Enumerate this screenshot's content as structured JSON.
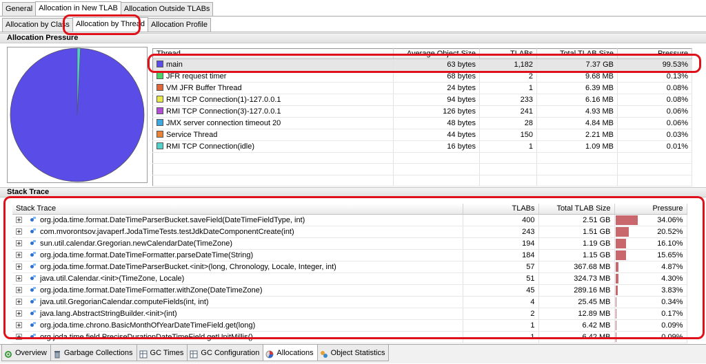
{
  "top_tabs": [
    "General",
    "Allocation in New TLAB",
    "Allocation Outside TLABs"
  ],
  "sub_tabs": [
    "Allocation by Class",
    "Allocation by Thread",
    "Allocation Profile"
  ],
  "pressure_section": {
    "title": "Allocation Pressure"
  },
  "pie": {
    "main_fraction": 0.9953,
    "main_color": "#5a4ce6",
    "other_color": "#55d0c8"
  },
  "thread_table": {
    "headers": [
      "Thread",
      "Average Object Size",
      "TLABs",
      "Total TLAB Size",
      "Pressure"
    ],
    "rows": [
      {
        "color": "#5a4ce6",
        "name": "main",
        "avg": "63 bytes",
        "tlabs": "1,182",
        "size": "7.37 GB",
        "pressure": "99.53%"
      },
      {
        "color": "#4fd16a",
        "name": "JFR request timer",
        "avg": "68 bytes",
        "tlabs": "2",
        "size": "9.68 MB",
        "pressure": "0.13%"
      },
      {
        "color": "#e0663c",
        "name": "VM JFR Buffer Thread",
        "avg": "24 bytes",
        "tlabs": "1",
        "size": "6.39 MB",
        "pressure": "0.08%"
      },
      {
        "color": "#e8e84a",
        "name": "RMI TCP Connection(1)-127.0.0.1",
        "avg": "94 bytes",
        "tlabs": "233",
        "size": "6.16 MB",
        "pressure": "0.08%"
      },
      {
        "color": "#b14fd6",
        "name": "RMI TCP Connection(3)-127.0.0.1",
        "avg": "126 bytes",
        "tlabs": "241",
        "size": "4.93 MB",
        "pressure": "0.06%"
      },
      {
        "color": "#3fa8e0",
        "name": "JMX server connection timeout 20",
        "avg": "48 bytes",
        "tlabs": "28",
        "size": "4.84 MB",
        "pressure": "0.06%"
      },
      {
        "color": "#e8843a",
        "name": "Service Thread",
        "avg": "44 bytes",
        "tlabs": "150",
        "size": "2.21 MB",
        "pressure": "0.03%"
      },
      {
        "color": "#55d0c8",
        "name": "RMI TCP Connection(idle)",
        "avg": "16 bytes",
        "tlabs": "1",
        "size": "1.09 MB",
        "pressure": "0.01%"
      }
    ]
  },
  "stack_section": {
    "title": "Stack Trace"
  },
  "stack_table": {
    "headers": [
      "Stack Trace",
      "TLABs",
      "Total TLAB Size",
      "Pressure"
    ],
    "rows": [
      {
        "frame": "org.joda.time.format.DateTimeParserBucket.saveField(DateTimeFieldType, int)",
        "tlabs": "400",
        "size": "2.51 GB",
        "pressure": "34.06%",
        "fraction": 0.3406
      },
      {
        "frame": "com.mvorontsov.javaperf.JodaTimeTests.testJdkDateComponentCreate(int)",
        "tlabs": "243",
        "size": "1.51 GB",
        "pressure": "20.52%",
        "fraction": 0.2052
      },
      {
        "frame": "sun.util.calendar.Gregorian.newCalendarDate(TimeZone)",
        "tlabs": "194",
        "size": "1.19 GB",
        "pressure": "16.10%",
        "fraction": 0.161
      },
      {
        "frame": "org.joda.time.format.DateTimeFormatter.parseDateTime(String)",
        "tlabs": "184",
        "size": "1.15 GB",
        "pressure": "15.65%",
        "fraction": 0.1565
      },
      {
        "frame": "org.joda.time.format.DateTimeParserBucket.<init>(long, Chronology, Locale, Integer, int)",
        "tlabs": "57",
        "size": "367.68 MB",
        "pressure": "4.87%",
        "fraction": 0.0487
      },
      {
        "frame": "java.util.Calendar.<init>(TimeZone, Locale)",
        "tlabs": "51",
        "size": "324.73 MB",
        "pressure": "4.30%",
        "fraction": 0.043
      },
      {
        "frame": "org.joda.time.format.DateTimeFormatter.withZone(DateTimeZone)",
        "tlabs": "45",
        "size": "289.16 MB",
        "pressure": "3.83%",
        "fraction": 0.0383
      },
      {
        "frame": "java.util.GregorianCalendar.computeFields(int, int)",
        "tlabs": "4",
        "size": "25.45 MB",
        "pressure": "0.34%",
        "fraction": 0.0034
      },
      {
        "frame": "java.lang.AbstractStringBuilder.<init>(int)",
        "tlabs": "2",
        "size": "12.89 MB",
        "pressure": "0.17%",
        "fraction": 0.0017
      },
      {
        "frame": "org.joda.time.chrono.BasicMonthOfYearDateTimeField.get(long)",
        "tlabs": "1",
        "size": "6.42 MB",
        "pressure": "0.09%",
        "fraction": 0.0009
      },
      {
        "frame": "org.joda.time.field.PreciseDurationDateTimeField.getUnitMillis()",
        "tlabs": "1",
        "size": "6.42 MB",
        "pressure": "0.09%",
        "fraction": 0.0009
      }
    ]
  },
  "bottom_tabs": [
    {
      "label": "Overview",
      "icon": "overview-icon"
    },
    {
      "label": "Garbage Collections",
      "icon": "trash-icon"
    },
    {
      "label": "GC Times",
      "icon": "table-icon"
    },
    {
      "label": "GC Configuration",
      "icon": "table-icon"
    },
    {
      "label": "Allocations",
      "icon": "allocations-icon"
    },
    {
      "label": "Object Statistics",
      "icon": "objects-icon"
    }
  ]
}
